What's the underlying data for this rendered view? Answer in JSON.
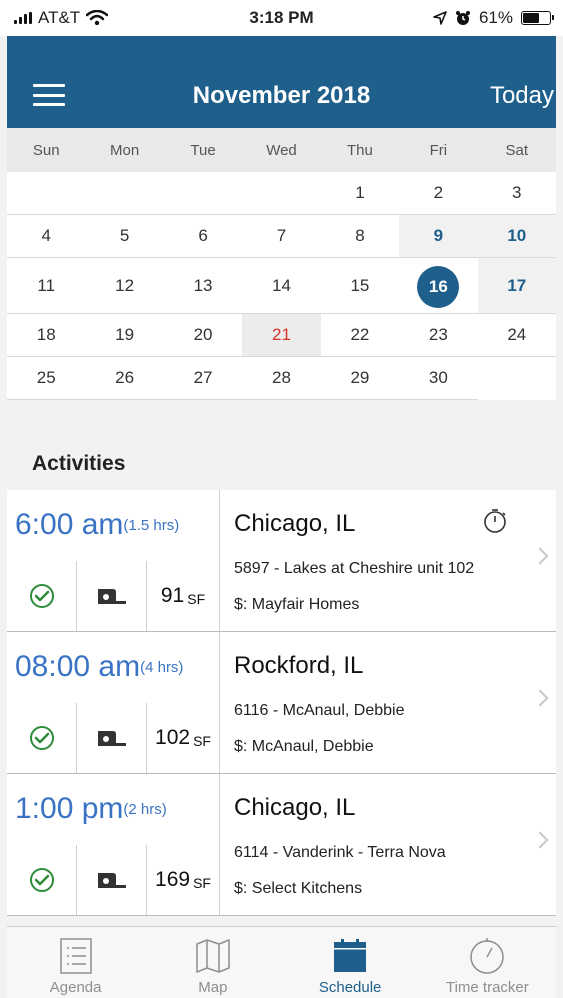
{
  "status_bar": {
    "carrier": "AT&T",
    "time": "3:18 PM",
    "battery": "61%",
    "battery_level": 0.61
  },
  "header": {
    "title": "November 2018",
    "today_label": "Today"
  },
  "calendar": {
    "weekdays": [
      "Sun",
      "Mon",
      "Tue",
      "Wed",
      "Thu",
      "Fri",
      "Sat"
    ],
    "weeks": [
      [
        "",
        "",
        "",
        "",
        "1",
        "2",
        "3"
      ],
      [
        "4",
        "5",
        "6",
        "7",
        "8",
        "9",
        "10"
      ],
      [
        "11",
        "12",
        "13",
        "14",
        "15",
        "16",
        "17"
      ],
      [
        "18",
        "19",
        "20",
        "21",
        "22",
        "23",
        "24"
      ],
      [
        "25",
        "26",
        "27",
        "28",
        "29",
        "30",
        ""
      ]
    ],
    "selected_day": "16",
    "marked_day": "21",
    "highlight_days": [
      "9",
      "10",
      "17"
    ]
  },
  "activities": {
    "title": "Activities",
    "items": [
      {
        "time": "6:00 am",
        "duration": "(1.5 hrs)",
        "city": "Chicago, IL",
        "job": "5897 - Lakes at Cheshire unit 102",
        "client": "$: Mayfair Homes",
        "area": "91",
        "area_unit": "SF",
        "has_timer": true
      },
      {
        "time": "08:00 am",
        "duration": "(4 hrs)",
        "city": "Rockford, IL",
        "job": "6116 - McAnaul, Debbie",
        "client": "$: McAnaul, Debbie",
        "area": "102",
        "area_unit": "SF",
        "has_timer": false
      },
      {
        "time": "1:00 pm",
        "duration": "(2 hrs)",
        "city": "Chicago, IL",
        "job": "6114 - Vanderink - Terra Nova",
        "client": "$: Select Kitchens",
        "area": "169",
        "area_unit": "SF",
        "has_timer": false
      }
    ]
  },
  "tabs": [
    {
      "label": "Agenda",
      "icon": "agenda-icon"
    },
    {
      "label": "Map",
      "icon": "map-icon"
    },
    {
      "label": "Schedule",
      "icon": "calendar-icon",
      "active": true
    },
    {
      "label": "Time tracker",
      "icon": "stopwatch-icon"
    }
  ],
  "colors": {
    "brand": "#1f5f8b",
    "time_blue": "#3a73c4",
    "accent_red": "#d9342b",
    "check_green": "#2e8b3a"
  }
}
